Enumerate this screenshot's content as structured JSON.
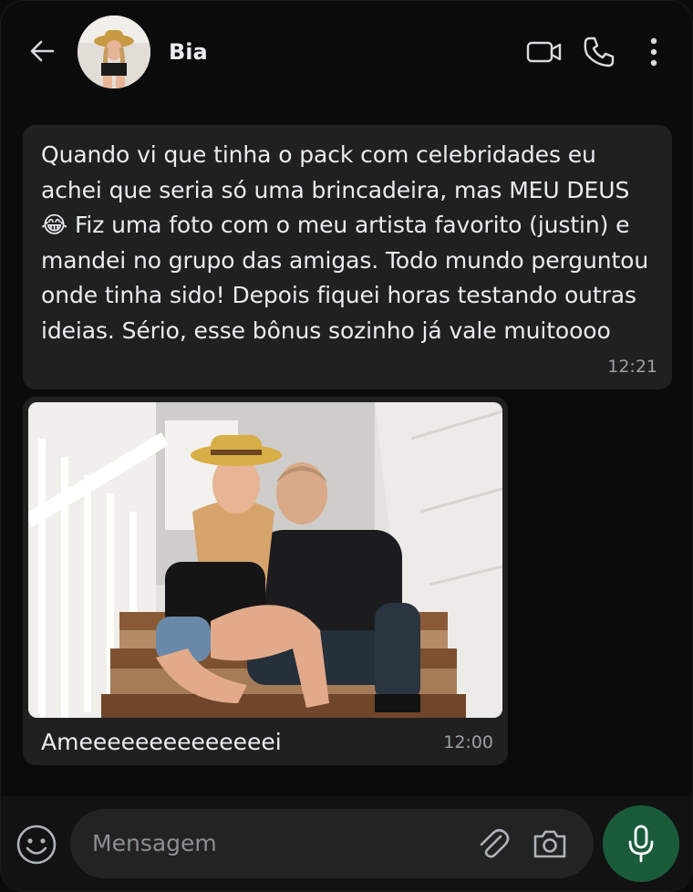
{
  "header": {
    "contact_name": "Bia",
    "icons": [
      "back-arrow-icon",
      "avatar",
      "video-call-icon",
      "voice-call-icon",
      "more-options-icon"
    ]
  },
  "messages": [
    {
      "type": "text",
      "text": "Quando vi que tinha o pack com celebridades eu achei que seria só uma brincadeira, mas MEU DEUS 😂 Fiz uma foto com o meu artista favorito (justin) e mandei no grupo das amigas. Todo mundo perguntou onde tinha sido! Depois fiquei horas testando outras ideias. Sério, esse bônus sozinho já vale muitoooo",
      "time": "12:21"
    },
    {
      "type": "image",
      "caption": "Ameeeeeeeeeeeeeei",
      "time": "12:00"
    }
  ],
  "composer": {
    "placeholder": "Mensagem",
    "icons": [
      "emoji-icon",
      "attach-icon",
      "camera-icon",
      "mic-icon"
    ]
  },
  "colors": {
    "background": "#0b0b0b",
    "bubble": "#202020",
    "input": "#232323",
    "mic_button": "#1a5b3c",
    "time_text": "#9aa0a3"
  }
}
